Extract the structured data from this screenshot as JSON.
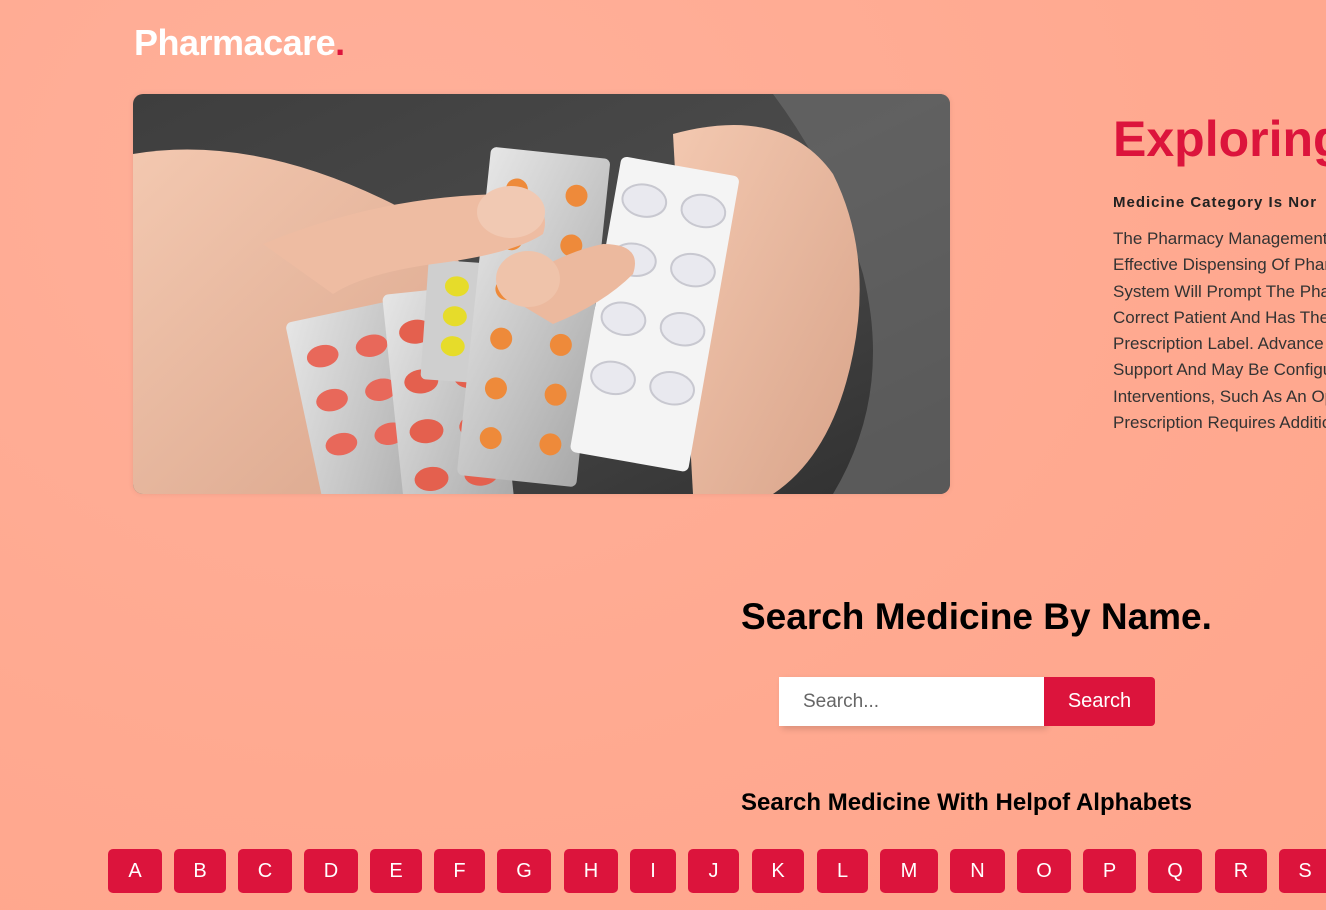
{
  "brand": {
    "name": "Pharmacare",
    "dot": "."
  },
  "hero": {
    "image_alt": "hands holding blister packs of pills"
  },
  "explore": {
    "title": "Exploring",
    "subtitle": "Medicine Category Is Nor",
    "body_lines": [
      "The Pharmacy Management",
      "Effective Dispensing Of Phar",
      "System Will Prompt The Pha",
      "Correct Patient And Has The",
      "Prescription Label. Advance",
      "Support And May Be Configu",
      "Interventions, Such As An Op",
      "Prescription Requires Additio"
    ]
  },
  "search": {
    "title": "Search Medicine By Name.",
    "placeholder": "Search...",
    "button_label": "Search"
  },
  "alphabet": {
    "title": "Search Medicine With Helpof Alphabets",
    "letters": [
      "A",
      "B",
      "C",
      "D",
      "E",
      "F",
      "G",
      "H",
      "I",
      "J",
      "K",
      "L",
      "M",
      "N",
      "O",
      "P",
      "Q",
      "R",
      "S"
    ]
  },
  "colors": {
    "background": "#ffab94",
    "accent": "#dc143c",
    "text": "#000000"
  }
}
